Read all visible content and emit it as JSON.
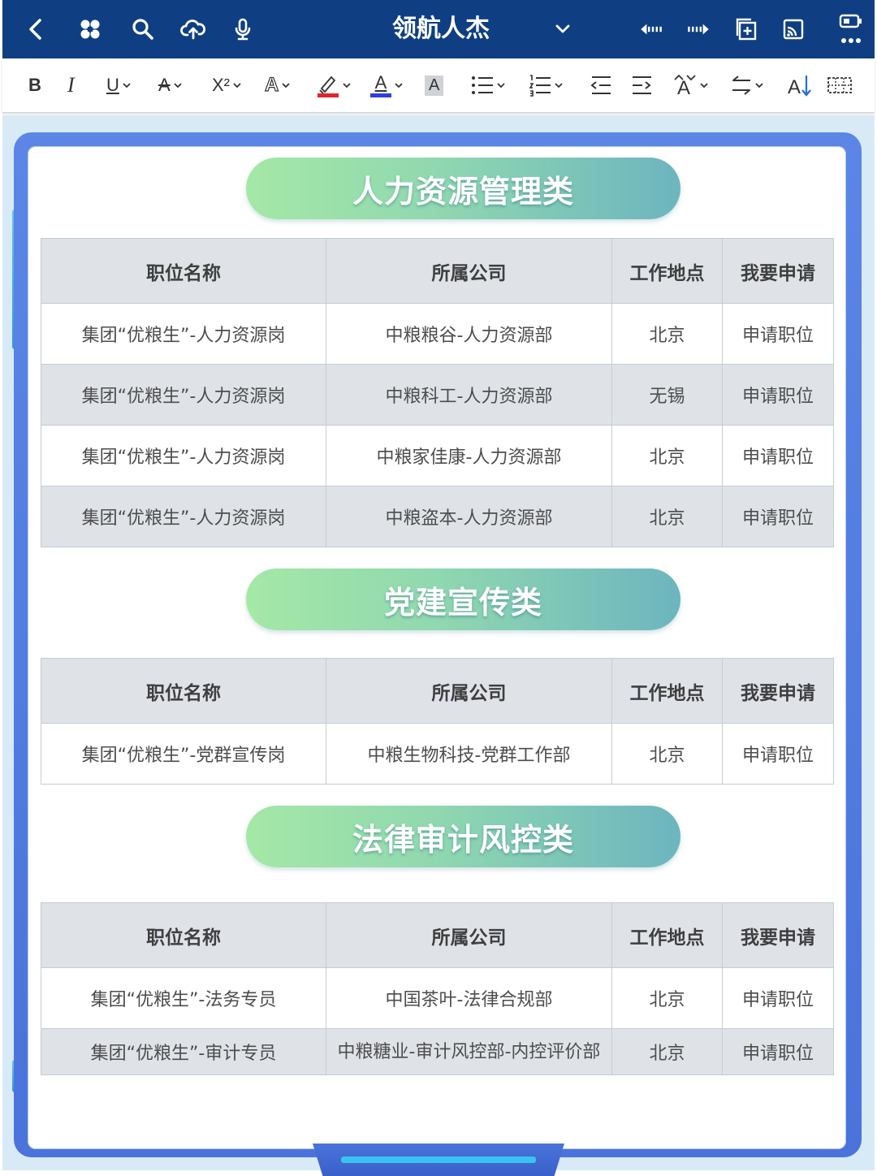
{
  "app": {
    "title": "领航人杰"
  },
  "toolbar_top": {
    "icons": [
      "back-icon",
      "app-grid-icon",
      "search-icon",
      "cloud-upload-icon",
      "microphone-icon",
      "chevron-down-icon",
      "undo-icon",
      "redo-icon",
      "add-page-icon",
      "cast-icon",
      "battery-icon",
      "more-icon"
    ]
  },
  "format_toolbar": {
    "bold": "B",
    "italic": "I",
    "underline": "U",
    "strike": "A",
    "superscript": "X²",
    "font_bg": "A",
    "highlight_color": "#e0262a",
    "font_color_letter": "A",
    "font_color": "#2f3fdc",
    "char_shading": "A"
  },
  "sections": [
    {
      "title": "人力资源管理类",
      "headers": [
        "职位名称",
        "所属公司",
        "工作地点",
        "我要申请"
      ],
      "rows": [
        [
          "集团“优粮生”-人力资源岗",
          "中粮粮谷-人力资源部",
          "北京",
          "申请职位"
        ],
        [
          "集团“优粮生”-人力资源岗",
          "中粮科工-人力资源部",
          "无锡",
          "申请职位"
        ],
        [
          "集团“优粮生”-人力资源岗",
          "中粮家佳康-人力资源部",
          "北京",
          "申请职位"
        ],
        [
          "集团“优粮生”-人力资源岗",
          "中粮盗本-人力资源部",
          "北京",
          "申请职位"
        ]
      ]
    },
    {
      "title": "党建宣传类",
      "headers": [
        "职位名称",
        "所属公司",
        "工作地点",
        "我要申请"
      ],
      "rows": [
        [
          "集团“优粮生”-党群宣传岗",
          "中粮生物科技-党群工作部",
          "北京",
          "申请职位"
        ]
      ]
    },
    {
      "title": "法律审计风控类",
      "headers": [
        "职位名称",
        "所属公司",
        "工作地点",
        "我要申请"
      ],
      "rows": [
        [
          "集团“优粮生”-法务专员",
          "中国茶叶-法律合规部",
          "北京",
          "申请职位"
        ],
        [
          "集团“优粮生”-审计专员",
          "中粮糖业-审计风控部-内控评价部",
          "北京",
          "申请职位"
        ]
      ]
    }
  ]
}
